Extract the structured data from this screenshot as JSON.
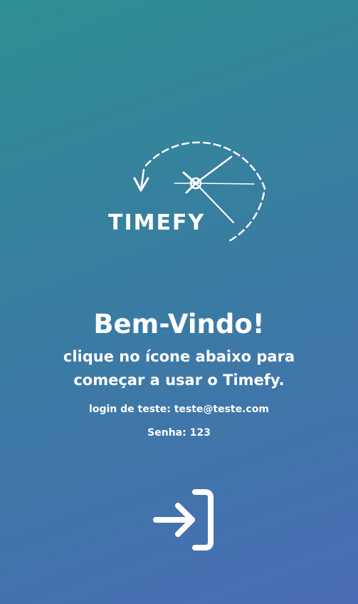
{
  "app": {
    "logo_text": "TIMEFY",
    "icon": "clock-logo-icon"
  },
  "welcome": {
    "title": "Bem-Vindo!",
    "subtitle_line1": "clique no ícone abaixo para",
    "subtitle_line2": "começar a usar o Timefy.",
    "test_login": "login de teste: teste@teste.com",
    "test_password": "Senha: 123"
  },
  "actions": {
    "login_icon": "login-arrow-icon"
  },
  "colors": {
    "gradient_start": "#2e8e93",
    "gradient_end": "#4a6db5",
    "text": "#ffffff"
  }
}
